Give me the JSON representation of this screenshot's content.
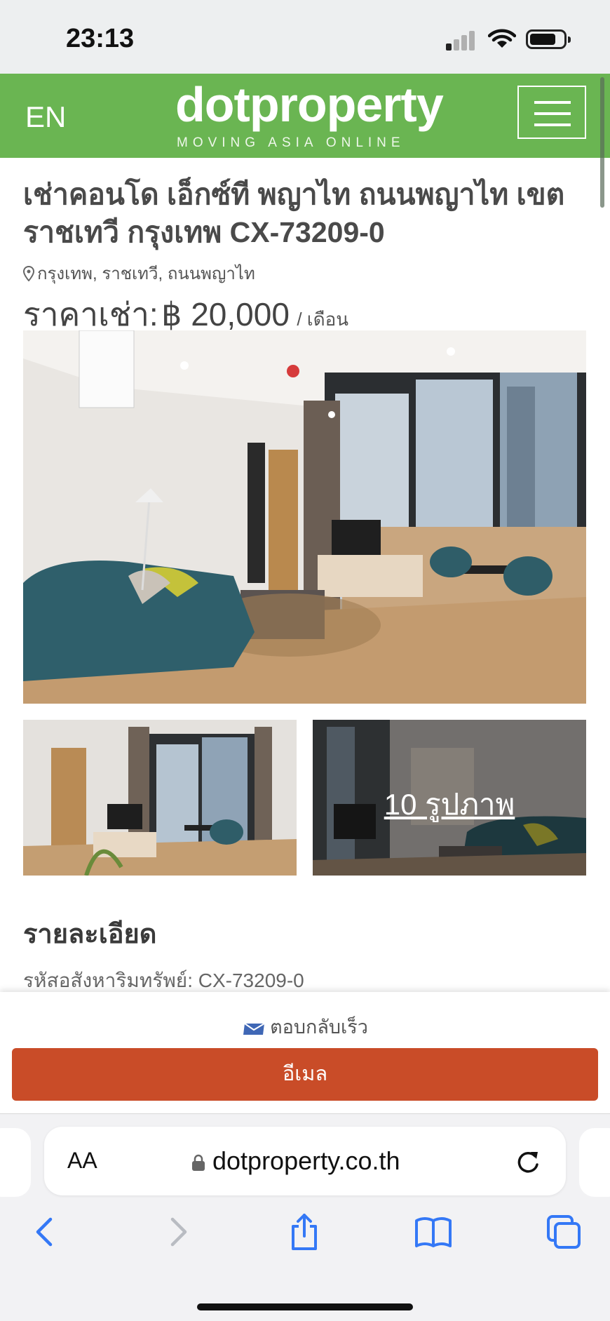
{
  "status_bar": {
    "time": "23:13"
  },
  "header": {
    "language": "EN",
    "logo_text": "dotproperty",
    "logo_tagline": "MOVING ASIA ONLINE",
    "brand_color": "#6ab552"
  },
  "listing": {
    "title": "เช่าคอนโด เอ็กซ์ที พญาไท ถนนพญาไท เขตราชเทวี กรุงเทพ CX-73209-0",
    "location": "กรุงเทพ, ราชเทวี, ถนนพญาไท",
    "price_label": "ราคาเช่า:",
    "price_value": "฿ 20,000",
    "price_unit": "/ เดือน",
    "photo_count_label": "10 รูปภาพ"
  },
  "details": {
    "heading": "รายละเอียด",
    "property_code_line": "รหัสอสังหาริมทรัพย์: CX-73209-0"
  },
  "contact_bar": {
    "quick_reply_label": "ตอบกลับเร็ว",
    "email_button_label": "อีเมล",
    "button_color": "#c94c28"
  },
  "browser": {
    "text_size_label": "AA",
    "url": "dotproperty.co.th",
    "icons": [
      "back-icon",
      "forward-icon",
      "share-icon",
      "bookmarks-icon",
      "tabs-icon",
      "reload-icon",
      "lock-icon"
    ]
  }
}
